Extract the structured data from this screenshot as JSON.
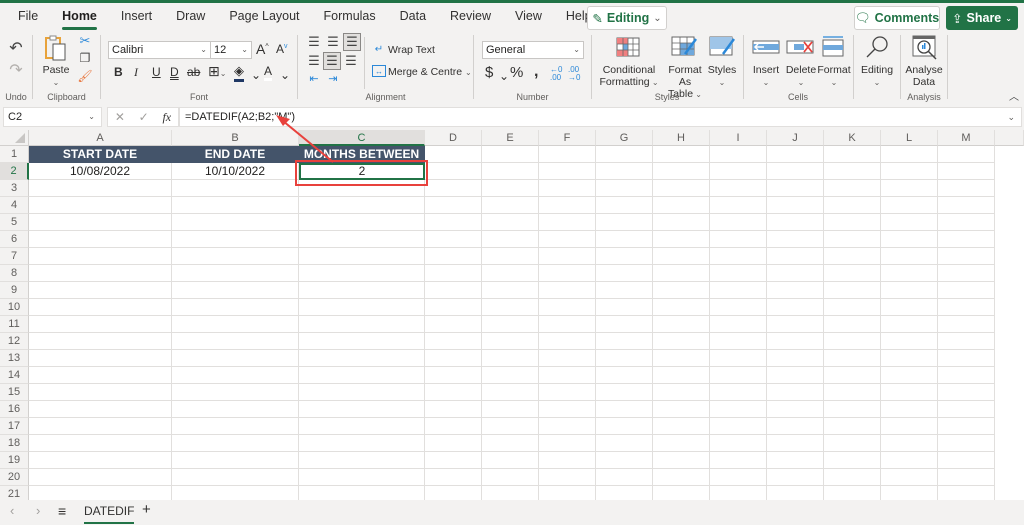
{
  "menu": {
    "items": [
      "File",
      "Home",
      "Insert",
      "Draw",
      "Page Layout",
      "Formulas",
      "Data",
      "Review",
      "View",
      "Help"
    ],
    "active": "Home",
    "editing_label": "Editing",
    "comments_label": "Comments",
    "share_label": "Share"
  },
  "ribbon": {
    "undo_group": "Undo",
    "clipboard_group": "Clipboard",
    "paste_label": "Paste",
    "font_group": "Font",
    "font_name": "Calibri",
    "font_size": "12",
    "bold": "B",
    "italic": "I",
    "underline": "U",
    "double_underline": "D",
    "strikethrough": "ab",
    "font_color": "A",
    "alignment_group": "Alignment",
    "wrap_text": "Wrap Text",
    "merge_centre": "Merge & Centre",
    "number_group": "Number",
    "number_format": "General",
    "currency": "$",
    "percent": "%",
    "comma": "ʙ",
    "styles_group": "Styles",
    "conditional_formatting_1": "Conditional",
    "conditional_formatting_2": "Formatting",
    "format_as_table_1": "Format As",
    "format_as_table_2": "Table",
    "styles_label": "Styles",
    "cells_group": "Cells",
    "insert_label": "Insert",
    "delete_label": "Delete",
    "format_label": "Format",
    "editing_label": "Editing",
    "analysis_group": "Analysis",
    "analyse_data_1": "Analyse",
    "analyse_data_2": "Data"
  },
  "formula_bar": {
    "name_box": "C2",
    "fx": "fx",
    "formula": "=DATEDIF(A2;B2;\"M\")"
  },
  "grid": {
    "columns": [
      "A",
      "B",
      "C",
      "D",
      "E",
      "F",
      "G",
      "H",
      "I",
      "J",
      "K",
      "L",
      "M"
    ],
    "rows": [
      "1",
      "2",
      "3",
      "4",
      "5",
      "6",
      "7",
      "8",
      "9",
      "10",
      "11",
      "12",
      "13",
      "14",
      "15",
      "16",
      "17",
      "18",
      "19",
      "20",
      "21"
    ],
    "selected_cell": "C2",
    "headers": [
      "START DATE",
      "END DATE",
      "MONTHS BETWEEN"
    ],
    "row2": [
      "10/08/2022",
      "10/10/2022",
      "2"
    ]
  },
  "sheets": {
    "tabs": [
      "DATEDIF"
    ],
    "active": "DATEDIF"
  },
  "colors": {
    "accent": "#217346",
    "header_fill": "#44546a",
    "annotation_red": "#e8413c"
  }
}
